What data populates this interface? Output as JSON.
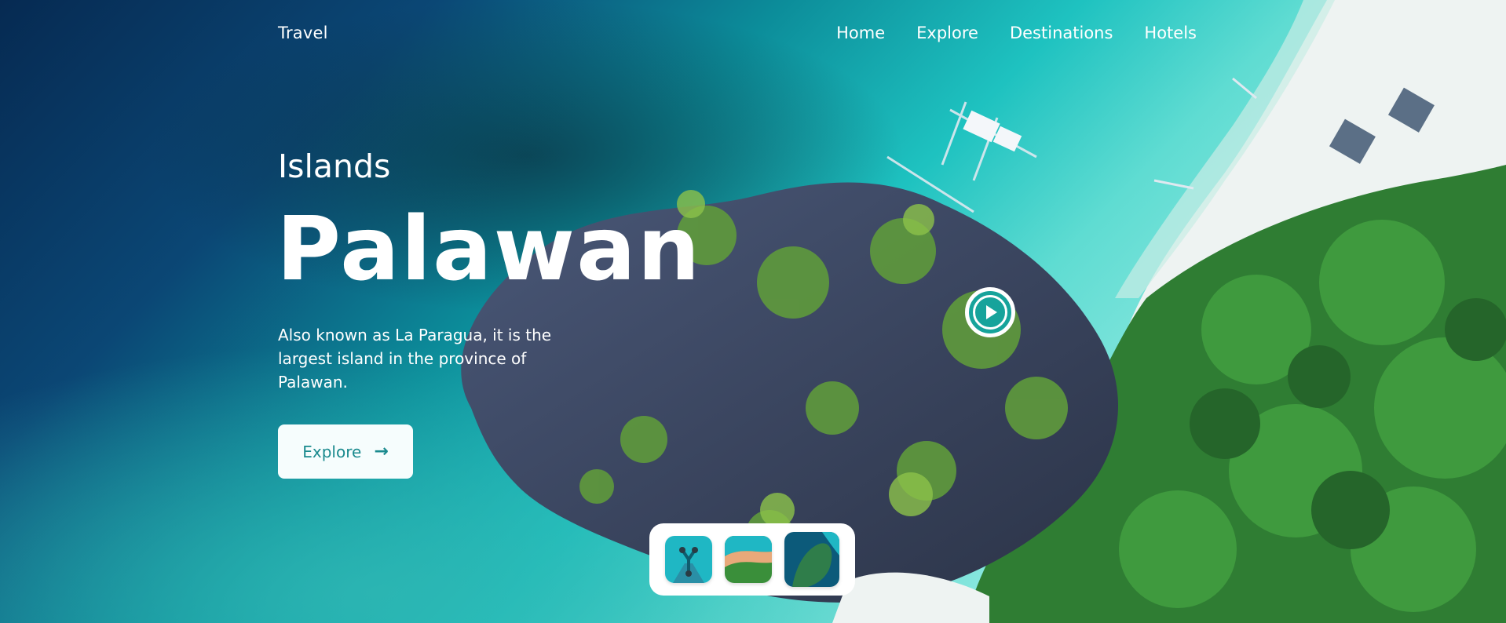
{
  "header": {
    "brand": "Travel",
    "nav": [
      "Home",
      "Explore",
      "Destinations",
      "Hotels"
    ]
  },
  "hero": {
    "eyebrow": "Islands",
    "title": "Palawan",
    "description": "Also known as La Paragua, it is the largest island in the province of Palawan.",
    "cta_label": "Explore",
    "cta_icon": "arrow-right-icon"
  },
  "media": {
    "play_icon": "play-circle-icon"
  },
  "thumbnails": {
    "count": 3,
    "active_index": 2
  },
  "colors": {
    "accent": "#1a8a8e",
    "button_bg": "#f6fdfd",
    "ocean_deep": "#0b3c63",
    "lagoon": "#22c4c0",
    "sand": "#eef3f2",
    "jungle": "#2f7d33",
    "rock": "#3b4660"
  }
}
